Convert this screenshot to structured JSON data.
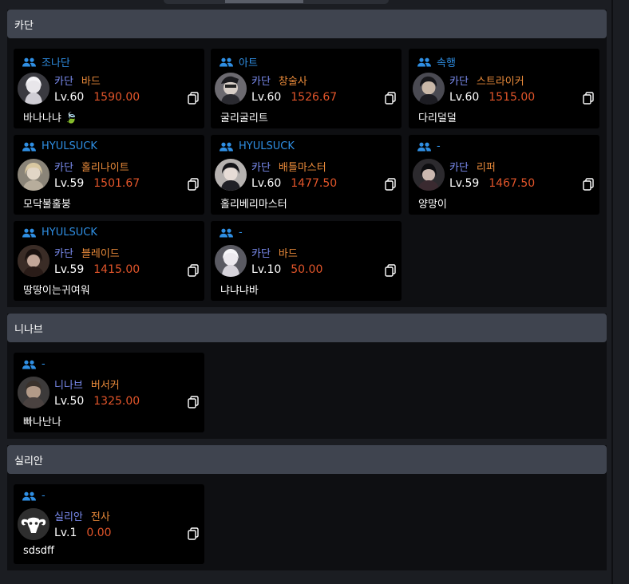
{
  "sections": [
    {
      "header": "카단",
      "cards": [
        {
          "guild": "조나단",
          "server": "카단",
          "class": "바드",
          "level": "Lv.60",
          "item_level": "1590.00",
          "name": "바나나냐 🍃",
          "avatar": "a1"
        },
        {
          "guild": "아트",
          "server": "카단",
          "class": "창술사",
          "level": "Lv.60",
          "item_level": "1526.67",
          "name": "굴리굴리트",
          "avatar": "a2"
        },
        {
          "guild": "속행",
          "server": "카단",
          "class": "스트라이커",
          "level": "Lv.60",
          "item_level": "1515.00",
          "name": "다리덜덜",
          "avatar": "a3"
        },
        {
          "guild": "HYULSUCK",
          "server": "카단",
          "class": "홀리나이트",
          "level": "Lv.59",
          "item_level": "1501.67",
          "name": "모닥불훌붕",
          "avatar": "a4"
        },
        {
          "guild": "HYULSUCK",
          "server": "카단",
          "class": "배틀마스터",
          "level": "Lv.60",
          "item_level": "1477.50",
          "name": "홀리베리마스터",
          "avatar": "a5"
        },
        {
          "guild": "-",
          "server": "카단",
          "class": "리퍼",
          "level": "Lv.59",
          "item_level": "1467.50",
          "name": "양망이",
          "avatar": "a6"
        },
        {
          "guild": "HYULSUCK",
          "server": "카단",
          "class": "블레이드",
          "level": "Lv.59",
          "item_level": "1415.00",
          "name": "땅땅이는귀여워",
          "avatar": "a7"
        },
        {
          "guild": "-",
          "server": "카단",
          "class": "바드",
          "level": "Lv.10",
          "item_level": "50.00",
          "name": "냐냐냐바",
          "avatar": "a1"
        }
      ]
    },
    {
      "header": "니나브",
      "cards": [
        {
          "guild": "-",
          "server": "니나브",
          "class": "버서커",
          "level": "Lv.50",
          "item_level": "1325.00",
          "name": "빠나난나",
          "avatar": "a8"
        }
      ]
    },
    {
      "header": "실리안",
      "cards": [
        {
          "guild": "-",
          "server": "실리안",
          "class": "전사",
          "level": "Lv.1",
          "item_level": "0.00",
          "name": "sdsdff",
          "avatar": "ram"
        }
      ]
    }
  ],
  "colors": {
    "guild": "#2f8fe4",
    "server": "#7b8cf0",
    "class": "#e98a3a",
    "item_level": "#e2552a",
    "section_header_bg": "#3f444f"
  },
  "icons": {
    "guild": "people-icon",
    "copy": "copy-icon"
  }
}
